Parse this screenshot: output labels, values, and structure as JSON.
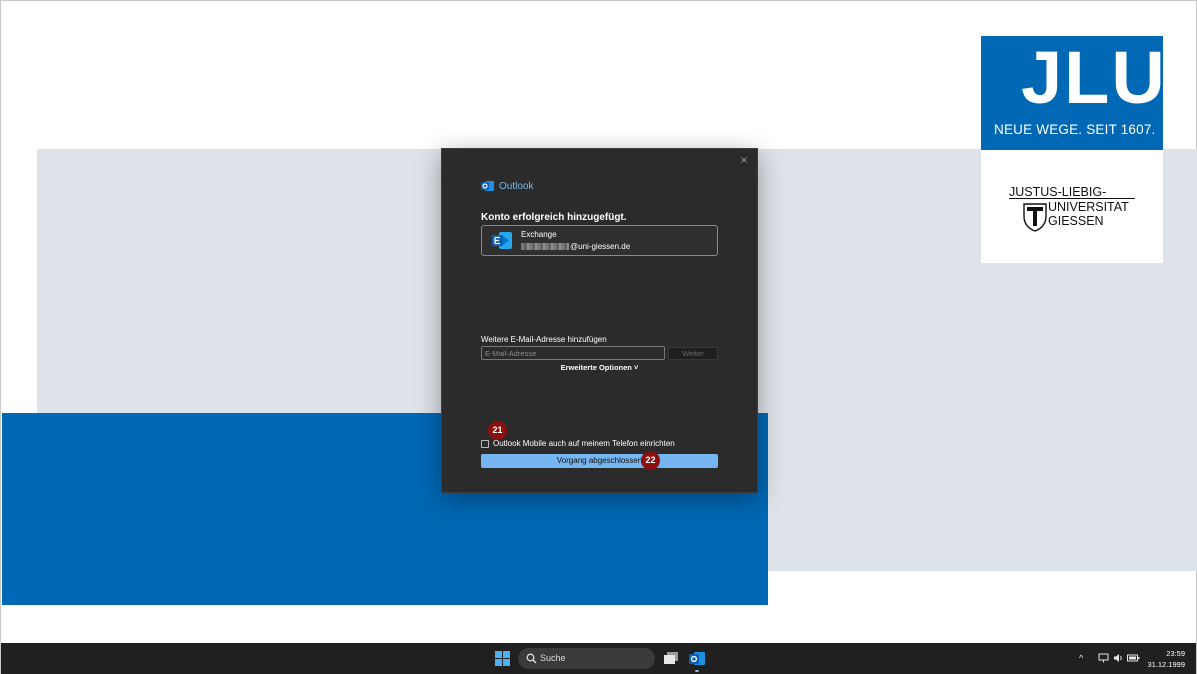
{
  "logo": {
    "acronym": "JLU",
    "tagline": "NEUE WEGE. SEIT 1607.",
    "name_line1": "JUSTUS-LIEBIG-",
    "name_line2": "UNIVERSITAT",
    "name_line3": "GIESSEN"
  },
  "dialog": {
    "app_name": "Outlook",
    "close_glyph": "×",
    "title": "Konto erfolgreich hinzugefügt.",
    "account": {
      "type": "Exchange",
      "email_domain": "@uni-giessen.de"
    },
    "add_email_label": "Weitere E-Mail-Adresse hinzufügen",
    "email_placeholder": "E-Mail-Adresse",
    "next_button": "Weiter",
    "advanced_options": "Erweiterte Optionen ˅",
    "mobile_checkbox_label": "Outlook Mobile auch auf meinem Telefon einrichten",
    "mobile_checked": false,
    "done_button": "Vorgang abgeschlossen"
  },
  "markers": {
    "step_checkbox": "21",
    "step_done": "22"
  },
  "taskbar": {
    "search_label": "Suche",
    "tray_chevron": "^",
    "time": "23:59",
    "date": "31.12.1999"
  },
  "colors": {
    "brand_blue": "#0068b4",
    "dialog_bg": "#2b2b2b",
    "primary_button": "#75b6f0",
    "marker": "#8b0f0f",
    "desktop_gray": "#dde3e9"
  },
  "icons": [
    "outlook-icon",
    "exchange-icon",
    "close-icon",
    "windows-start-icon",
    "search-icon",
    "task-view-icon",
    "outlook-taskbar-icon",
    "network-icon",
    "volume-icon",
    "battery-icon"
  ]
}
